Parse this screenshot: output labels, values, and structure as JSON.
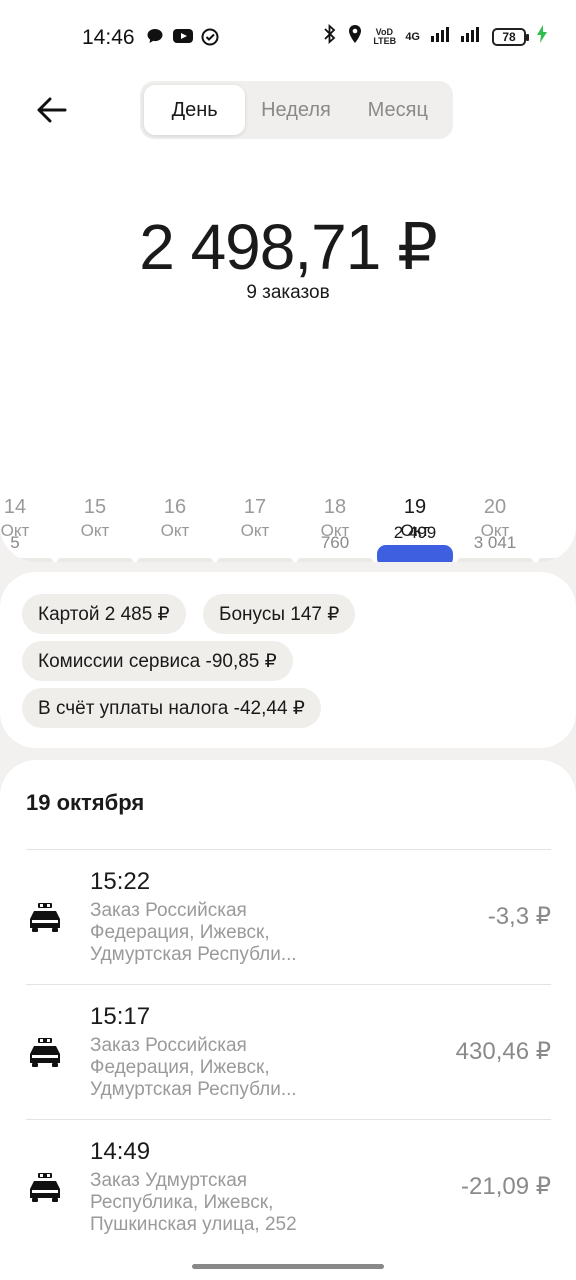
{
  "status_bar": {
    "time": "14:46",
    "network_label": "VoD LTEB",
    "network_type": "4G",
    "battery": "78",
    "icons": [
      "messenger-icon",
      "youtube-icon",
      "check-circle-icon",
      "bluetooth-icon",
      "location-icon",
      "wifi-icon",
      "signal-icon",
      "charging-icon"
    ]
  },
  "header": {
    "back_icon": "arrow-left-icon",
    "tabs": [
      {
        "label": "День",
        "active": true
      },
      {
        "label": "Неделя",
        "active": false
      },
      {
        "label": "Месяц",
        "active": false
      }
    ]
  },
  "summary": {
    "total": "2 498,71 ₽",
    "orders": "9 заказов"
  },
  "chart_data": {
    "type": "bar",
    "values_labels": [
      "5",
      "",
      "",
      "",
      "760",
      "2 499",
      "3 041"
    ],
    "days": [
      {
        "day": "14",
        "month": "Окт",
        "value_label": "5",
        "selected": false
      },
      {
        "day": "15",
        "month": "Окт",
        "value_label": "",
        "selected": false
      },
      {
        "day": "16",
        "month": "Окт",
        "value_label": "",
        "selected": false
      },
      {
        "day": "17",
        "month": "Окт",
        "value_label": "",
        "selected": false
      },
      {
        "day": "18",
        "month": "Окт",
        "value_label": "760",
        "selected": false
      },
      {
        "day": "19",
        "month": "Окт",
        "value_label": "2 499",
        "selected": true
      },
      {
        "day": "20",
        "month": "Окт",
        "value_label": "3 041",
        "selected": false
      }
    ],
    "accent_color": "#3d5fe0"
  },
  "chips": [
    "Картой 2 485 ₽",
    "Бонусы 147 ₽",
    "Комиссии сервиса -90,85 ₽",
    "В счёт уплаты налога -42,44 ₽"
  ],
  "list": {
    "title": "19 октября",
    "rows": [
      {
        "time": "15:22",
        "desc": [
          "Заказ Российская",
          "Федерация, Ижевск,",
          "Удмуртская Республи..."
        ],
        "amount": "-3,3 ₽",
        "icon": "taxi-car-icon"
      },
      {
        "time": "15:17",
        "desc": [
          "Заказ Российская",
          "Федерация, Ижевск,",
          "Удмуртская Республи..."
        ],
        "amount": "430,46 ₽",
        "icon": "taxi-car-icon"
      },
      {
        "time": "14:49",
        "desc": [
          "Заказ Удмуртская",
          "Республика, Ижевск,",
          "Пушкинская улица, 252"
        ],
        "amount": "-21,09 ₽",
        "icon": "taxi-car-icon"
      }
    ]
  }
}
